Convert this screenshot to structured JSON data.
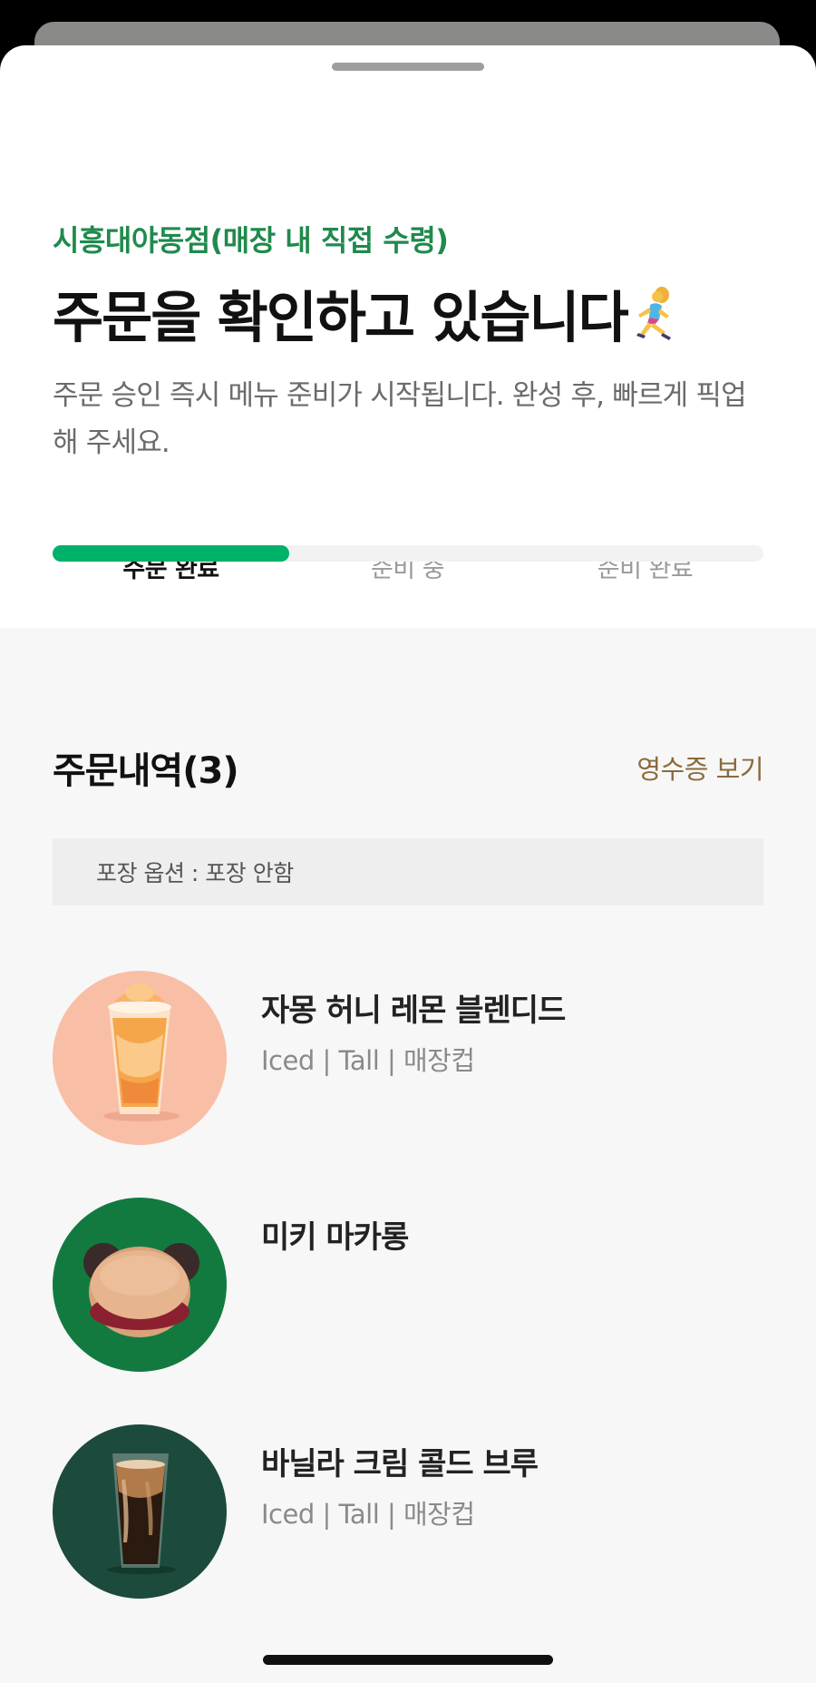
{
  "header": {
    "store_name": "시흥대야동점(매장 내 직접 수령)",
    "headline": "주문을 확인하고 있습니다",
    "headline_icon": "person-running-icon",
    "subtext": "주문 승인 즉시 메뉴 준비가 시작됩니다. 완성 후, 빠르게 픽업해 주세요."
  },
  "progress": {
    "steps": [
      "주문 완료",
      "준비 중",
      "준비 완료"
    ],
    "current_step": 1,
    "fraction": 0.333,
    "fill_color": "#00b16a"
  },
  "order": {
    "title": "주문내역(3)",
    "receipt_link": "영수증 보기",
    "packaging_option": "포장 옵션 : 포장 안함",
    "items": [
      {
        "name": "자몽 허니 레몬 블렌디드",
        "options": "Iced | Tall | 매장컵",
        "thumb_bg": "#f9bea6",
        "thumb_icon": "blended-drink-icon"
      },
      {
        "name": "미키 마카롱",
        "options": "",
        "thumb_bg": "#137a3f",
        "thumb_icon": "mickey-macaron-icon"
      },
      {
        "name": "바닐라 크림 콜드 브루",
        "options": "Iced | Tall | 매장컵",
        "thumb_bg": "#1c4a3c",
        "thumb_icon": "cold-brew-icon"
      }
    ]
  },
  "colors": {
    "accent_green": "#1f8a4c",
    "receipt_link": "#8a6a3c"
  }
}
